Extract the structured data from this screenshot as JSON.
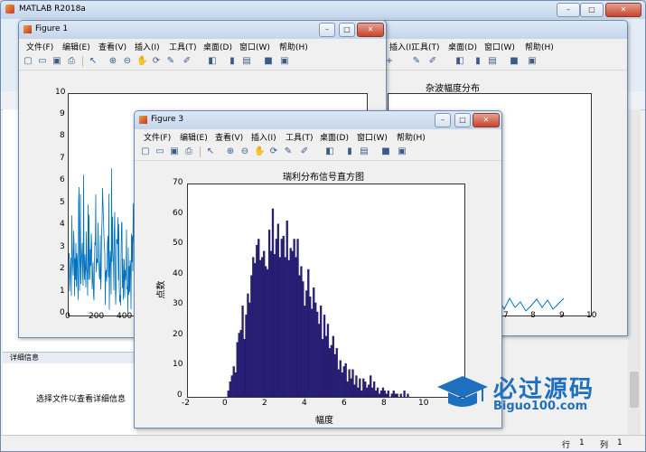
{
  "app": {
    "title": "MATLAB R2018a"
  },
  "details": {
    "header": "详细信息",
    "message": "选择文件以查看详细信息"
  },
  "statusbar": {
    "row_label": "行",
    "row_value": "1",
    "col_label": "列",
    "col_value": "1"
  },
  "menus": [
    "文件(F)",
    "编辑(E)",
    "查看(V)",
    "插入(I)",
    "工具(T)",
    "桌面(D)",
    "窗口(W)",
    "帮助(H)"
  ],
  "figure1": {
    "title": "Figure 1",
    "yticks": [
      "10",
      "9",
      "8",
      "7",
      "6",
      "5",
      "4",
      "3",
      "2",
      "1",
      "0"
    ],
    "xticks": [
      "0",
      "200",
      "400"
    ]
  },
  "figure2": {
    "title": "杂波幅度分布",
    "xticks": [
      "7",
      "8",
      "9",
      "10"
    ]
  },
  "figure3": {
    "title": "Figure 3",
    "chart_title": "瑞利分布信号直方图",
    "xlabel": "幅度",
    "ylabel": "点数",
    "yticks": [
      "70",
      "60",
      "50",
      "40",
      "30",
      "20",
      "10",
      "0"
    ],
    "xticks": [
      "-2",
      "0",
      "2",
      "4",
      "6",
      "8",
      "10"
    ]
  },
  "watermark": {
    "brand": "必过源码",
    "url": "Biguo100.com"
  },
  "chart_data": {
    "type": "bar",
    "title": "瑞利分布信号直方图",
    "xlabel": "幅度",
    "ylabel": "点数",
    "xlim": [
      -2,
      12
    ],
    "ylim": [
      0,
      70
    ],
    "bin_width": 0.09,
    "x": [
      0.05,
      0.14,
      0.23,
      0.32,
      0.41,
      0.5,
      0.59,
      0.68,
      0.77,
      0.86,
      0.95,
      1.04,
      1.13,
      1.22,
      1.31,
      1.4,
      1.49,
      1.58,
      1.67,
      1.76,
      1.85,
      1.94,
      2.03,
      2.12,
      2.21,
      2.3,
      2.39,
      2.48,
      2.57,
      2.66,
      2.75,
      2.84,
      2.93,
      3.02,
      3.11,
      3.2,
      3.29,
      3.38,
      3.47,
      3.56,
      3.65,
      3.74,
      3.83,
      3.92,
      4.01,
      4.1,
      4.19,
      4.28,
      4.37,
      4.46,
      4.55,
      4.64,
      4.73,
      4.82,
      4.91,
      5.0,
      5.09,
      5.18,
      5.27,
      5.36,
      5.45,
      5.54,
      5.63,
      5.72,
      5.81,
      5.9,
      5.99,
      6.08,
      6.17,
      6.26,
      6.35,
      6.44,
      6.53,
      6.62,
      6.71,
      6.8,
      6.89,
      6.98,
      7.07,
      7.16,
      7.25,
      7.34,
      7.43,
      7.52,
      7.61,
      7.7,
      7.79,
      7.88,
      7.97,
      8.06,
      8.15,
      8.24,
      8.33,
      8.42,
      8.51,
      8.6,
      8.69,
      8.78,
      8.87,
      8.96,
      9.05,
      9.14
    ],
    "values": [
      2,
      5,
      7,
      10,
      8,
      18,
      21,
      22,
      30,
      19,
      27,
      34,
      31,
      40,
      46,
      44,
      50,
      52,
      45,
      46,
      48,
      43,
      42,
      55,
      48,
      62,
      47,
      52,
      57,
      46,
      52,
      53,
      46,
      58,
      45,
      49,
      48,
      52,
      46,
      52,
      40,
      43,
      38,
      30,
      35,
      42,
      33,
      29,
      36,
      31,
      28,
      24,
      30,
      19,
      27,
      20,
      24,
      16,
      17,
      20,
      14,
      16,
      9,
      12,
      8,
      10,
      11,
      5,
      9,
      6,
      9,
      4,
      7,
      3,
      6,
      2,
      6,
      5,
      3,
      4,
      7,
      3,
      5,
      2,
      3,
      1,
      2,
      3,
      2,
      1,
      2,
      0,
      1,
      2,
      1,
      1,
      0,
      1,
      0,
      2,
      0,
      1
    ]
  }
}
